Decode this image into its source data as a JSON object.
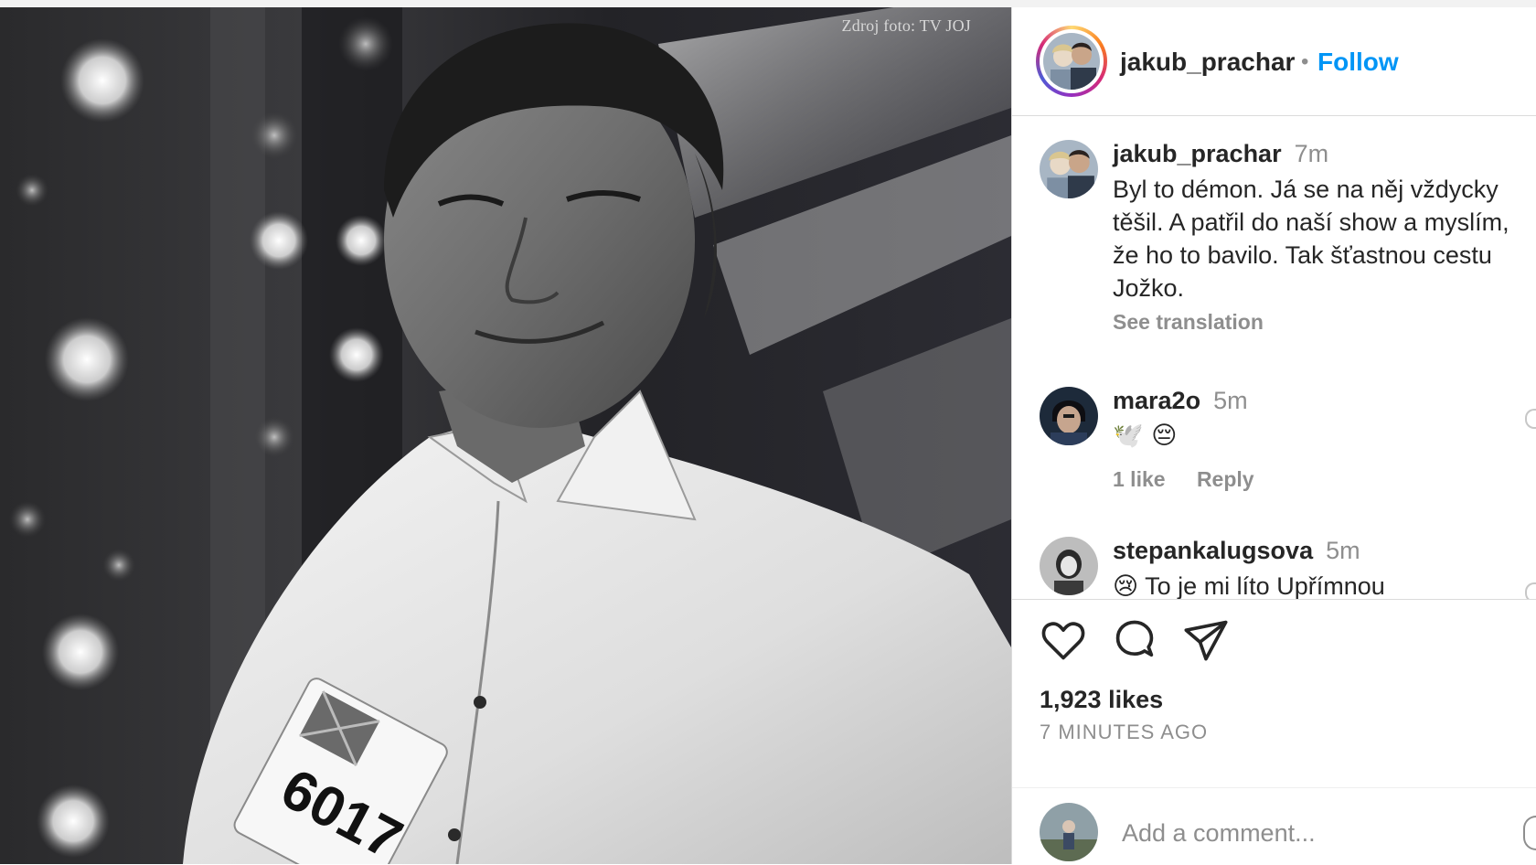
{
  "photo": {
    "credit": "Zdroj foto: TV JOJ",
    "badge_number": "6017"
  },
  "post": {
    "author": "jakub_prachar",
    "follow_label": "Follow",
    "separator": "•",
    "caption_author": "jakub_prachar",
    "caption_time": "7m",
    "caption": "Byl to démon. Já se na něj vždycky\ntěšil. A patřil do naší show a myslím,\nže ho to bavilo. Tak šťastnou cestu\nJožko.",
    "see_translation": "See translation",
    "likes": "1,923 likes",
    "time_ago": "7 MINUTES AGO"
  },
  "comments": [
    {
      "user": "mara2o",
      "time": "5m",
      "text": "🕊️ 😔",
      "likes": "1 like",
      "reply": "Reply"
    },
    {
      "user": "stepankalugsova",
      "time": "5m",
      "text": "😢 To je mi líto Upřímnou"
    }
  ],
  "actions": {
    "like_icon": "heart-icon",
    "comment_icon": "comment-bubble-icon",
    "share_icon": "paper-plane-icon"
  },
  "add_comment": {
    "placeholder": "Add a comment..."
  },
  "colors": {
    "link_blue": "#0095f6",
    "text": "#262626",
    "muted": "#8e8e8e",
    "border": "#dbdbdb"
  }
}
